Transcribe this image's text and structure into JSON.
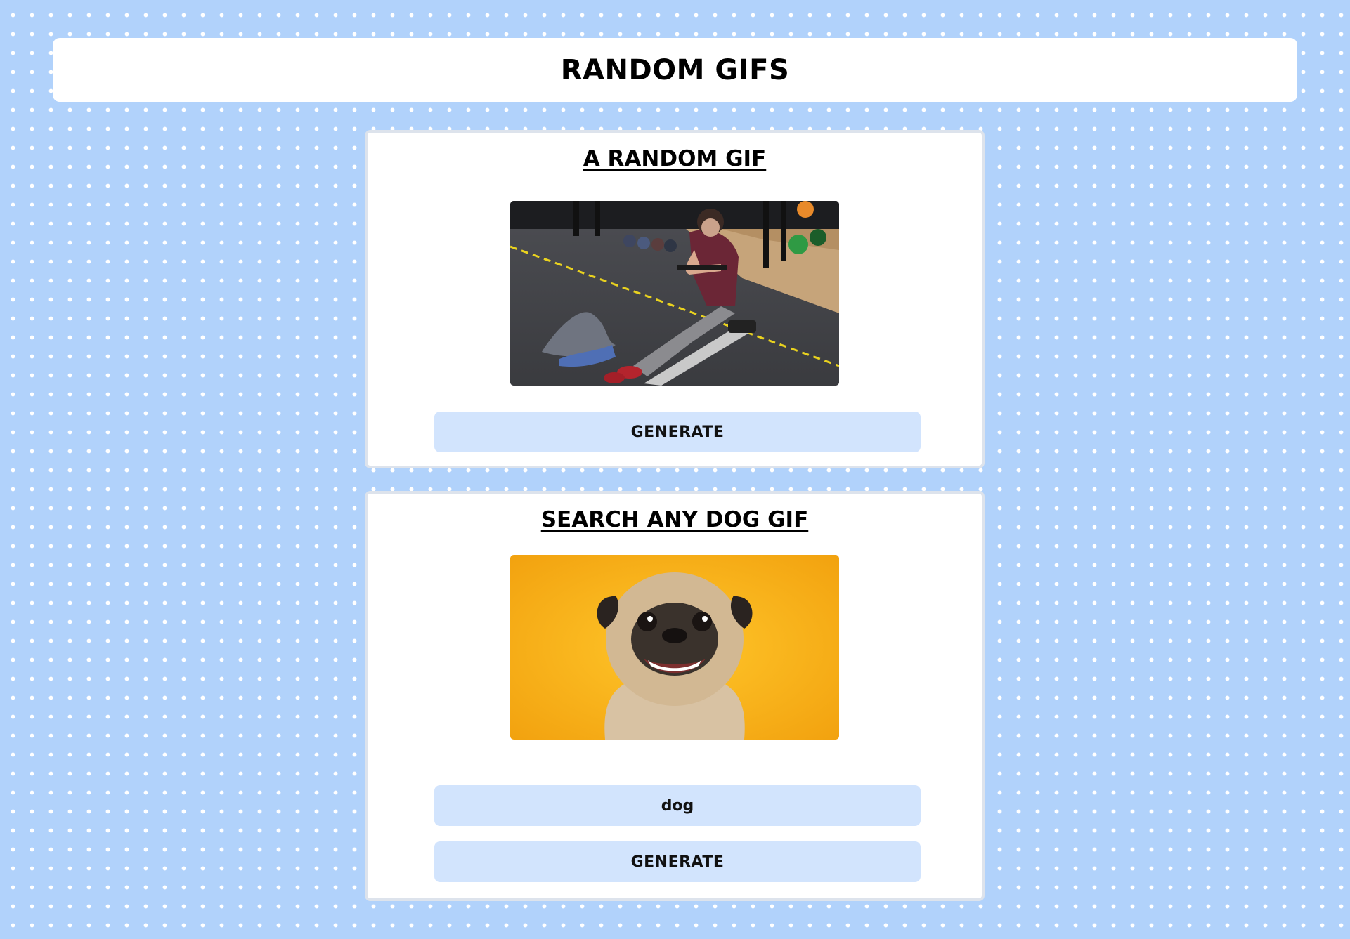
{
  "header": {
    "title": "RANDOM GIFS"
  },
  "random_section": {
    "title": "A RANDOM GIF",
    "gif_subject": "person on rowing machine in gym",
    "button_label": "GENERATE"
  },
  "search_section": {
    "title": "SEARCH ANY DOG GIF",
    "gif_subject": "smiling pug on yellow background",
    "search_value": "dog",
    "button_label": "GENERATE"
  },
  "colors": {
    "page_background": "#b1d2fb",
    "card_background": "#ffffff",
    "button_background": "#d2e4fd",
    "card_border": "#dde3ec"
  }
}
